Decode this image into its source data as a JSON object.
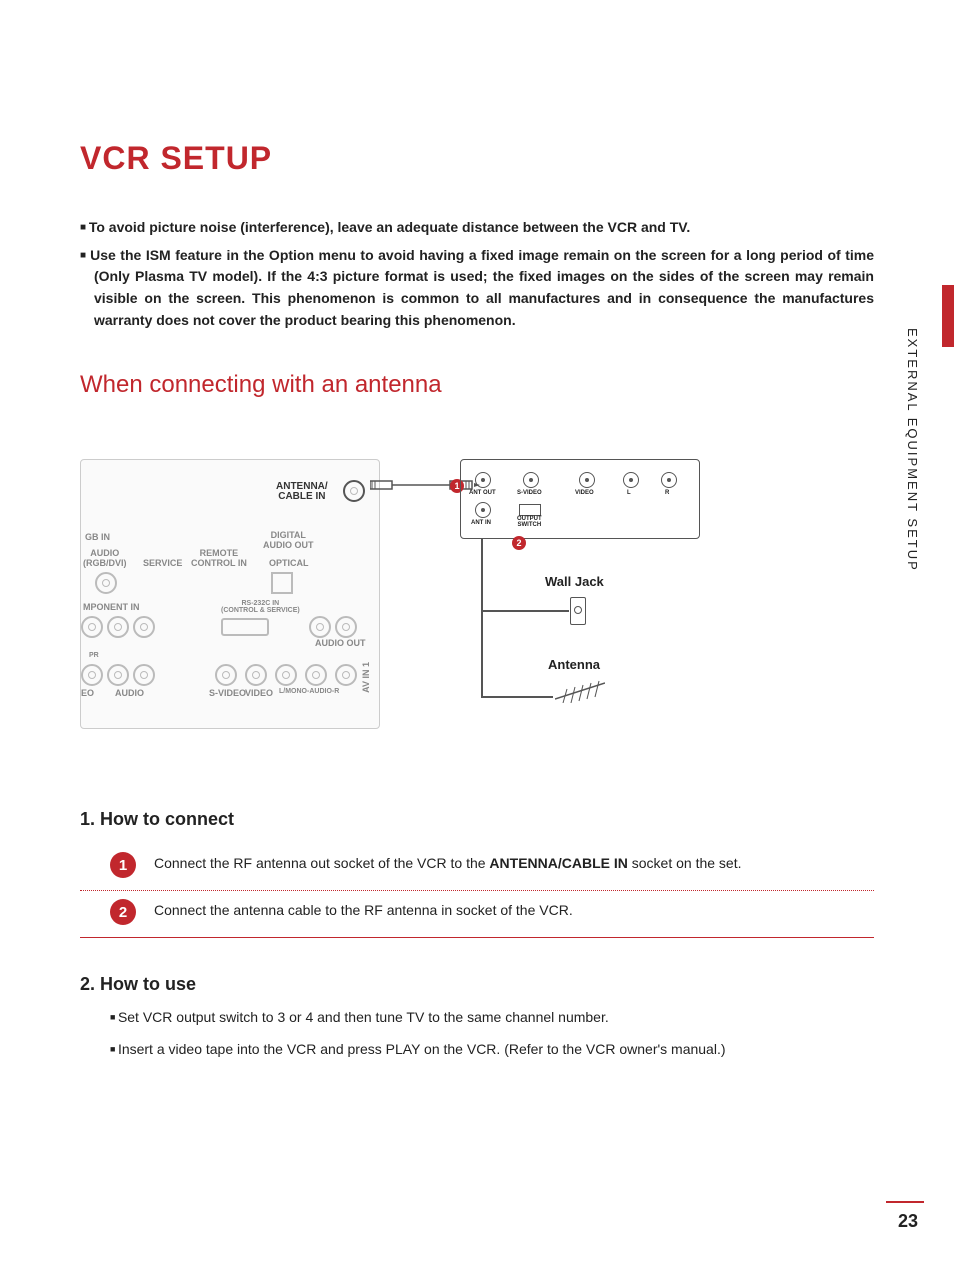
{
  "title": "VCR SETUP",
  "notes": [
    "To avoid picture noise (interference), leave an adequate distance between the VCR and TV.",
    "Use the ISM feature in the Option menu to avoid having a fixed image remain on the screen for a long period of time (Only Plasma TV model).  If the 4:3 picture format is used; the fixed images on the sides of the screen may remain visible on the screen. This phenomenon is common to all manufactures and in consequence the manufactures warranty does not cover the product bearing this phenomenon."
  ],
  "subheading": "When connecting with an antenna",
  "diagram": {
    "tv_panel": {
      "antenna_label_top": "ANTENNA/",
      "antenna_label_bottom": "CABLE IN",
      "labels": {
        "gb_in": "GB IN",
        "audio_rgbdvi": "AUDIO\n(RGB/DVI)",
        "service": "SERVICE",
        "remote": "REMOTE\nCONTROL IN",
        "digital_audio_out": "DIGITAL\nAUDIO OUT",
        "optical": "OPTICAL",
        "mponent_in": "MPONENT IN",
        "rs232c": "RS-232C IN\n(CONTROL & SERVICE)",
        "audio_out": "AUDIO OUT",
        "pr": "PR",
        "eo": "EO",
        "audio": "AUDIO",
        "svideo": "S-VIDEO",
        "video": "VIDEO",
        "mono_audio": "L/MONO-AUDIO-R",
        "av_in_1": "AV IN 1"
      }
    },
    "vcr": {
      "ant_out": "ANT OUT",
      "ant_in": "ANT IN",
      "svideo": "S-VIDEO",
      "video": "VIDEO",
      "l": "L",
      "r": "R",
      "output_switch": "OUTPUT\nSWITCH"
    },
    "wall_jack": "Wall Jack",
    "antenna": "Antenna",
    "badge1": "1",
    "badge2": "2"
  },
  "how_to_connect": {
    "heading": "1. How to connect",
    "steps": [
      {
        "num": "1",
        "text_before": "Connect the RF antenna out socket of the VCR to the ",
        "bold": "ANTENNA/CABLE IN",
        "text_after": " socket on the set."
      },
      {
        "num": "2",
        "text_before": "Connect the antenna cable to the RF antenna in socket of the VCR.",
        "bold": "",
        "text_after": ""
      }
    ]
  },
  "how_to_use": {
    "heading": "2. How to use",
    "bullets": [
      "Set VCR output switch to 3 or 4 and then tune TV to the same channel number.",
      "Insert a video tape into the VCR and press PLAY on the VCR. (Refer to the VCR owner's manual.)"
    ]
  },
  "side_text": "EXTERNAL EQUIPMENT SETUP",
  "page_number": "23"
}
